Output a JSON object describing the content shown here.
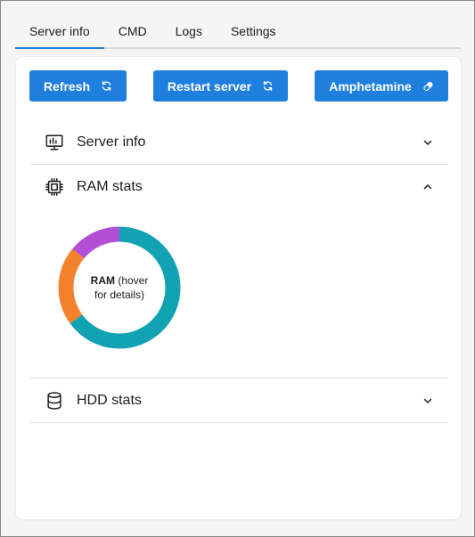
{
  "tabs": [
    {
      "label": "Server info",
      "active": true
    },
    {
      "label": "CMD",
      "active": false
    },
    {
      "label": "Logs",
      "active": false
    },
    {
      "label": "Settings",
      "active": false
    }
  ],
  "toolbar": {
    "refresh_label": "Refresh",
    "refresh_icon": "refresh-icon",
    "restart_label": "Restart server",
    "restart_icon": "restart-icon",
    "amphetamine_label": "Amphetamine",
    "amphetamine_icon": "pill-icon"
  },
  "sections": {
    "server_info": {
      "title": "Server info",
      "icon": "monitor-icon",
      "expanded": false
    },
    "ram_stats": {
      "title": "RAM stats",
      "icon": "cpu-chip-icon",
      "expanded": true
    },
    "hdd_stats": {
      "title": "HDD stats",
      "icon": "database-icon",
      "expanded": false
    }
  },
  "ram_chart": {
    "center_bold": "RAM",
    "center_rest": " (hover",
    "center_line2": "for details)"
  },
  "chart_data": {
    "type": "pie",
    "donut": true,
    "slices": [
      {
        "value": 0.65,
        "color": "#12a3b3"
      },
      {
        "value": 0.21,
        "color": "#f4812e"
      },
      {
        "value": 0.14,
        "color": "#b34fd6"
      }
    ]
  },
  "colors": {
    "accent": "#1e7fde",
    "tab_underline": "#1f7fd9"
  }
}
